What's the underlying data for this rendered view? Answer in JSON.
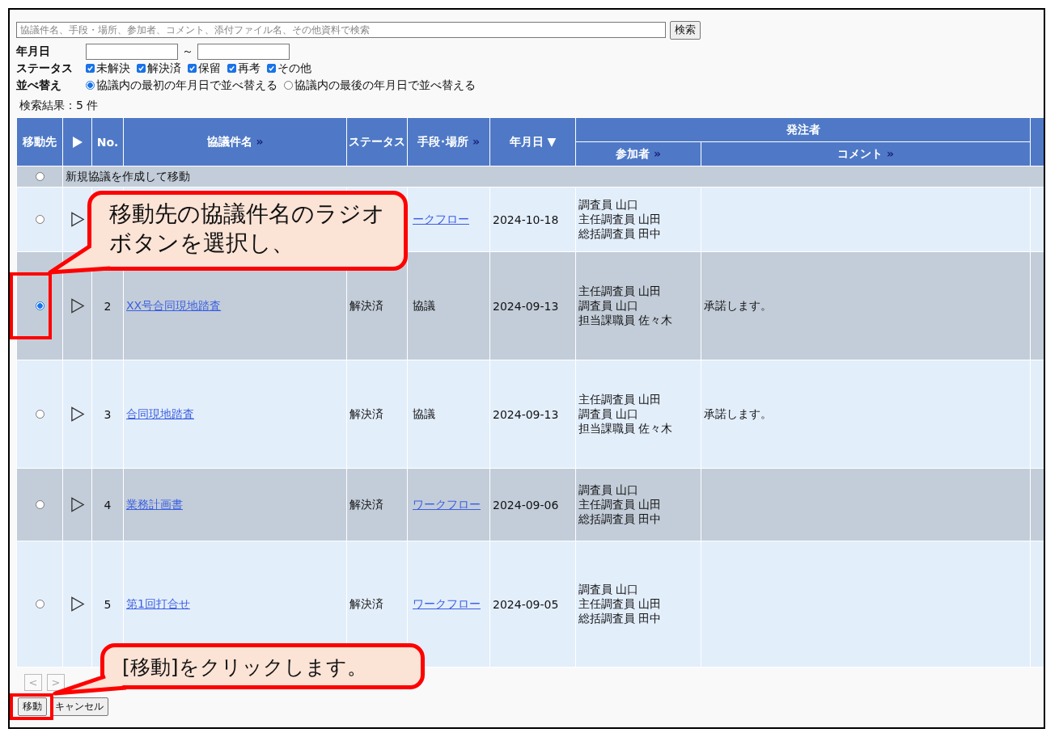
{
  "search": {
    "placeholder": "協議件名、手段・場所、参加者、コメント、添付ファイル名、その他資料で検索",
    "button": "検索"
  },
  "date_filter": {
    "label": "年月日",
    "separator": "～"
  },
  "status_filter": {
    "label": "ステータス",
    "options": [
      {
        "label": "未解決",
        "checked": true
      },
      {
        "label": "解決済",
        "checked": true
      },
      {
        "label": "保留",
        "checked": true
      },
      {
        "label": "再考",
        "checked": true
      },
      {
        "label": "その他",
        "checked": true
      }
    ]
  },
  "sort": {
    "label": "並べ替え",
    "options": [
      {
        "label": "協議内の最初の年月日で並べ替える",
        "selected": true
      },
      {
        "label": "協議内の最後の年月日で並べ替える",
        "selected": false
      }
    ]
  },
  "result_count": "検索結果：5 件",
  "table": {
    "columns": [
      {
        "kind": "text",
        "label": "移動先"
      },
      {
        "kind": "expand"
      },
      {
        "kind": "text",
        "label": "No."
      },
      {
        "kind": "text",
        "label": "協議件名",
        "more": "»"
      },
      {
        "kind": "text",
        "label": "ステータス"
      },
      {
        "kind": "text",
        "label": "手段･場所",
        "more": "»"
      },
      {
        "kind": "text",
        "label": "年月日",
        "sort": "▼"
      }
    ],
    "group": {
      "label": "発注者",
      "columns": [
        {
          "kind": "text",
          "label": "参加者",
          "more": "»"
        },
        {
          "kind": "text",
          "label": "コメント",
          "more": "»"
        }
      ]
    },
    "new_row": {
      "selected": false,
      "label": "新規協議を作成して移動"
    },
    "rows": [
      {
        "selected": false,
        "method": "ークフロー",
        "method_link": true,
        "date": "2024-10-18",
        "participants": [
          "調査員 山口",
          "主任調査員 山田",
          "総括調査員 田中"
        ]
      },
      {
        "selected": true,
        "no": "2",
        "title": "XX号合同現地踏査",
        "status": "解決済",
        "method": "協議",
        "method_link": false,
        "date": "2024-09-13",
        "participants": [
          "主任調査員 山田",
          "調査員 山口",
          "担当課職員 佐々木"
        ],
        "comment": "承諾します。"
      },
      {
        "selected": false,
        "no": "3",
        "title": "合同現地踏査",
        "status": "解決済",
        "method": "協議",
        "method_link": false,
        "date": "2024-09-13",
        "participants": [
          "主任調査員 山田",
          "調査員 山口",
          "担当課職員 佐々木"
        ],
        "comment": "承諾します。"
      },
      {
        "selected": false,
        "no": "4",
        "title": "業務計画書",
        "status": "解決済",
        "method": "ワークフロー",
        "method_link": true,
        "date": "2024-09-06",
        "participants": [
          "調査員 山口",
          "主任調査員 山田",
          "総括調査員 田中"
        ]
      },
      {
        "selected": false,
        "no": "5",
        "title": "第1回打合せ",
        "status": "解決済",
        "method": "ワークフロー",
        "method_link": true,
        "date": "2024-09-05",
        "participants": [
          "調査員 山口",
          "主任調査員 山田",
          "総括調査員 田中"
        ]
      }
    ]
  },
  "pager": [
    {
      "label": "<",
      "disabled": true
    },
    {
      "label": ">",
      "disabled": true
    }
  ],
  "actions": [
    {
      "label": "移動"
    },
    {
      "label": "キャンセル"
    }
  ],
  "callouts": [
    {
      "text": "移動先の協議件名のラジオボタンを選択し、"
    },
    {
      "text": "[移動]をクリックします。"
    }
  ]
}
